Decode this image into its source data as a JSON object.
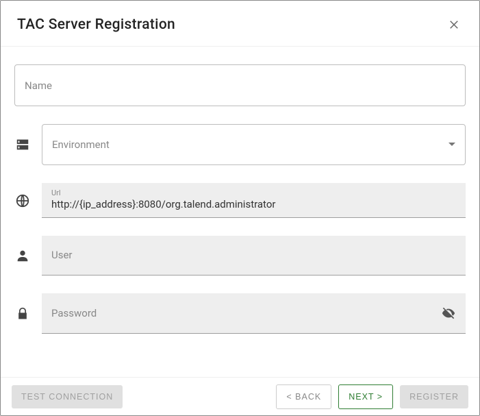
{
  "header": {
    "title": "TAC Server Registration"
  },
  "fields": {
    "name": {
      "label": "Name",
      "value": ""
    },
    "environment": {
      "label": "Environment",
      "value": ""
    },
    "url": {
      "label": "Url",
      "value": "http://{ip_address}:8080/org.talend.administrator"
    },
    "user": {
      "label": "User",
      "value": ""
    },
    "password": {
      "label": "Password",
      "value": ""
    }
  },
  "buttons": {
    "test_connection": "TEST CONNECTION",
    "back": "< BACK",
    "next": "NEXT >",
    "register": "REGISTER"
  }
}
